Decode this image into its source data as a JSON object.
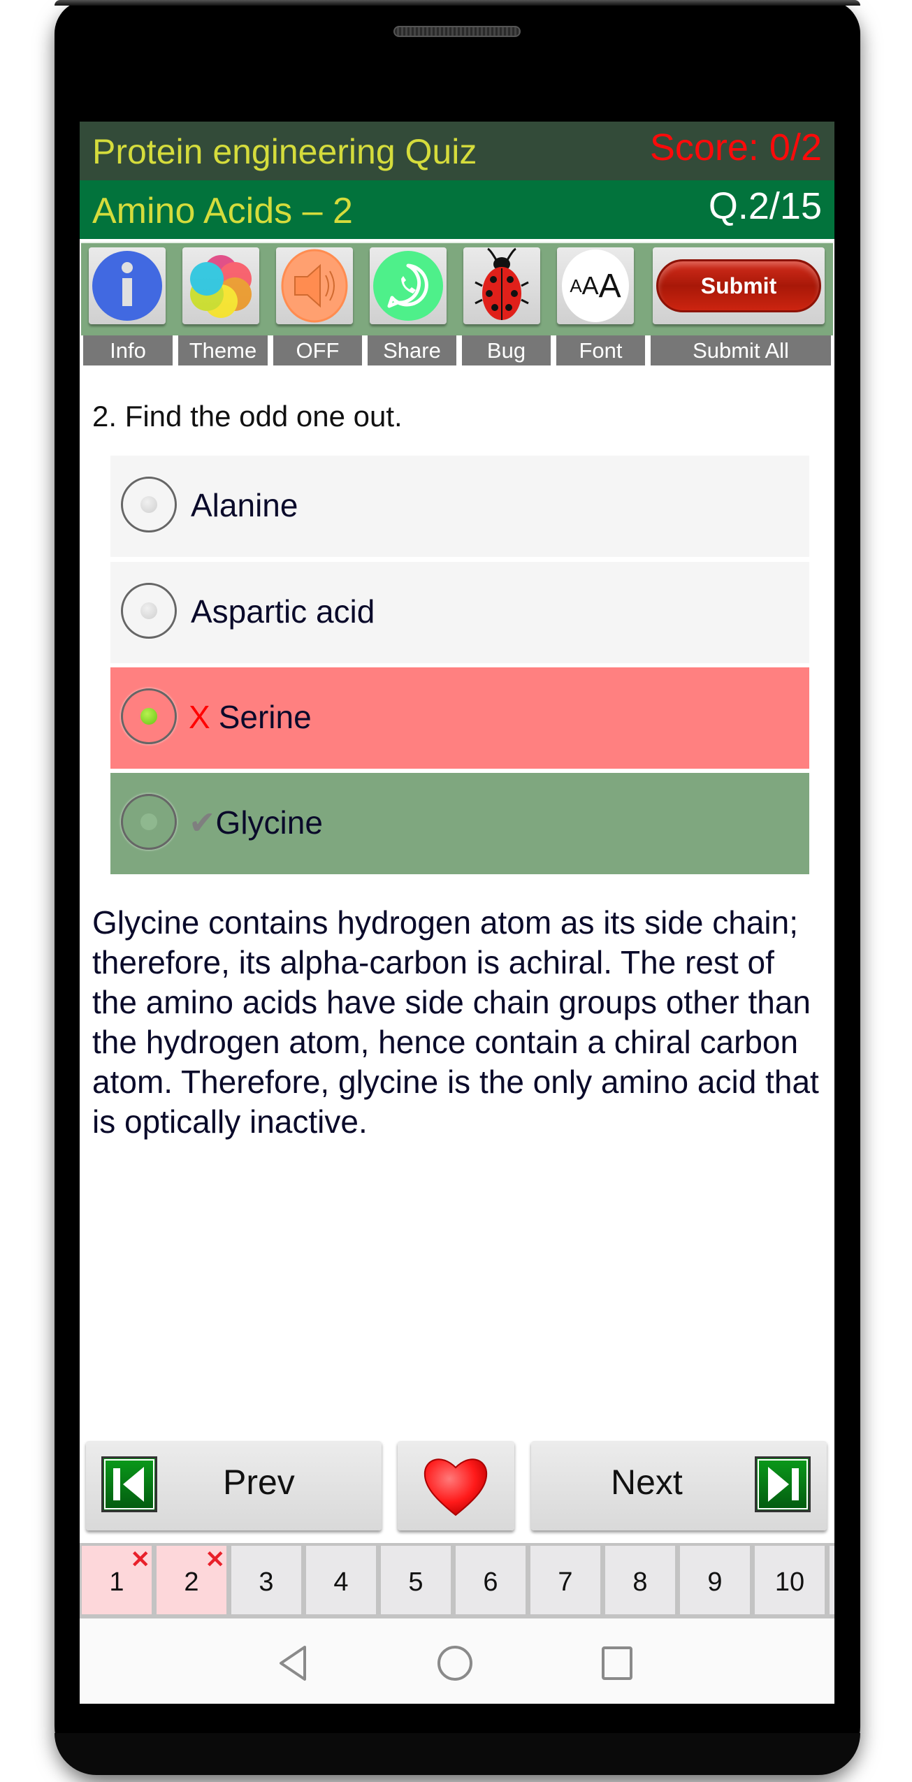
{
  "header": {
    "app_title": "Protein engineering Quiz",
    "score": "Score: 0/2",
    "topic": "Amino Acids – 2",
    "question_counter": "Q.2/15"
  },
  "toolbar": {
    "buttons": [
      {
        "icon": "info-icon",
        "label": "Info"
      },
      {
        "icon": "theme-palette-icon",
        "label": "Theme"
      },
      {
        "icon": "speaker-icon",
        "label": "OFF"
      },
      {
        "icon": "whatsapp-share-icon",
        "label": "Share"
      },
      {
        "icon": "ladybug-icon",
        "label": "Bug"
      },
      {
        "icon": "font-size-icon",
        "label": "Font"
      }
    ],
    "font_icon_text": "AAA",
    "submit_button": "Submit",
    "submit_all_label": "Submit All"
  },
  "question": {
    "text": "2. Find the odd one out.",
    "options": [
      {
        "text": "Alanine",
        "state": "unselected",
        "mark": ""
      },
      {
        "text": "Aspartic acid",
        "state": "unselected",
        "mark": ""
      },
      {
        "text": "Serine",
        "state": "selected-wrong",
        "mark": "X"
      },
      {
        "text": "Glycine",
        "state": "correct",
        "mark": "✔"
      }
    ],
    "explanation": "Glycine contains hydrogen atom as its side chain; therefore, its alpha-carbon is achiral. The rest of the amino acids have side chain groups other than the hydrogen atom, hence contain a chiral carbon atom. Therefore, glycine is the only amino acid that is optically inactive."
  },
  "navigation": {
    "prev_label": "Prev",
    "next_label": "Next",
    "favorite_icon": "heart-icon"
  },
  "pages": [
    {
      "num": "1",
      "status": "wrong",
      "mark": "✕"
    },
    {
      "num": "2",
      "status": "wrong",
      "mark": "✕"
    },
    {
      "num": "3",
      "status": "unanswered",
      "mark": ""
    },
    {
      "num": "4",
      "status": "unanswered",
      "mark": ""
    },
    {
      "num": "5",
      "status": "unanswered",
      "mark": ""
    },
    {
      "num": "6",
      "status": "unanswered",
      "mark": ""
    },
    {
      "num": "7",
      "status": "unanswered",
      "mark": ""
    },
    {
      "num": "8",
      "status": "unanswered",
      "mark": ""
    },
    {
      "num": "9",
      "status": "unanswered",
      "mark": ""
    },
    {
      "num": "10",
      "status": "unanswered",
      "mark": ""
    }
  ],
  "colors": {
    "header_dark": "#334b39",
    "header_green": "#02733c",
    "title_yellow": "#d5dc3c",
    "score_red": "#ff0a0a",
    "wrong_option": "#ff8080",
    "correct_option": "#7fa77f",
    "toolbar_green": "#7ea87e"
  }
}
